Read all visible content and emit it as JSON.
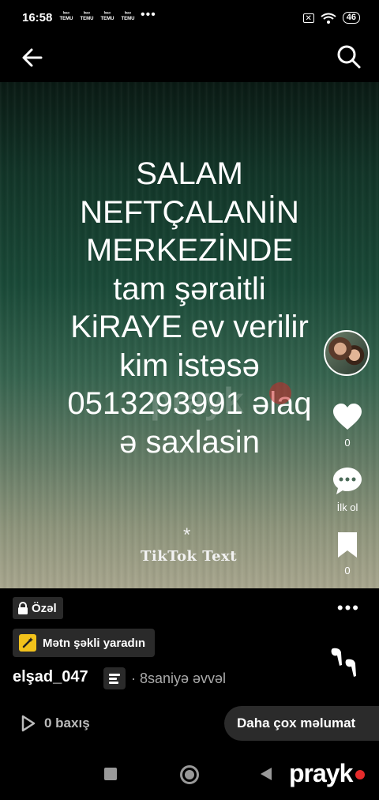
{
  "status_bar": {
    "time": "16:58",
    "notification_icons": [
      "TEMU",
      "TEMU",
      "TEMU",
      "TEMU"
    ],
    "notification_top": "ᵇᶦᵃᵒ",
    "more": "•••",
    "battery": "46"
  },
  "top_bar": {
    "back_icon": "arrow-left-icon",
    "search_icon": "search-icon"
  },
  "post": {
    "text_lines": [
      "SALAM",
      "NEFTÇALANİN",
      "MERKEZİNDE",
      "tam şəraitli",
      "KiRAYE  ev verilir",
      "kim istəsə",
      "0513293991 əlaq",
      "ə saxlasin"
    ],
    "watermark": "prayk",
    "sticker_star": "*",
    "sticker_label": "TikTok  Text",
    "background_colors": [
      "#0a1a14",
      "#1a4a38",
      "#667d67",
      "#a8a68e"
    ]
  },
  "actions": {
    "likes": "0",
    "comments_label": "İlk ol",
    "saves": "0"
  },
  "info": {
    "privacy_label": "Özəl",
    "more_menu": "•••",
    "create_button_label": "Mətn şəkli yaradın",
    "username": "elşad_047",
    "time_ago": "· 8saniyə əvvəl",
    "views": "0 baxış",
    "more_info_button": "Daha çox məlumat"
  },
  "nav_bar": {
    "brand": "prayk",
    "brand_color": "#e52b2b"
  }
}
